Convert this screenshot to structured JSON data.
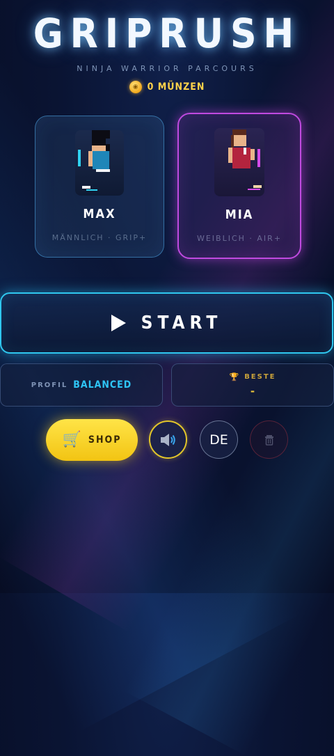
{
  "app": {
    "title": "GRIPRUSH",
    "subtitle": "NINJA WARRIOR PARCOURS",
    "coins_label": "0 MÜNZEN",
    "coin_icon": "coin-icon"
  },
  "characters": [
    {
      "name": "MAX",
      "description": "MÄNNLICH · GRIP+",
      "accent": "#2fc7ef",
      "selected": false
    },
    {
      "name": "MIA",
      "description": "WEIBLICH · AIR+",
      "accent": "#c04ae0",
      "selected": true
    }
  ],
  "start": {
    "label": "START",
    "icon": "play-icon"
  },
  "profile": {
    "label": "PROFIL",
    "value": "BALANCED"
  },
  "best": {
    "label": "BESTE",
    "value": "-",
    "icon": "trophy-icon"
  },
  "toolbar": {
    "shop_label": "SHOP",
    "shop_icon": "cart-icon",
    "sound_icon": "speaker-icon",
    "language": "DE",
    "delete_icon": "trash-icon"
  },
  "colors": {
    "cyan": "#2fc7ef",
    "magenta": "#c04ae0",
    "gold": "#ffd24a",
    "shop_yellow": "#f7d22a"
  }
}
